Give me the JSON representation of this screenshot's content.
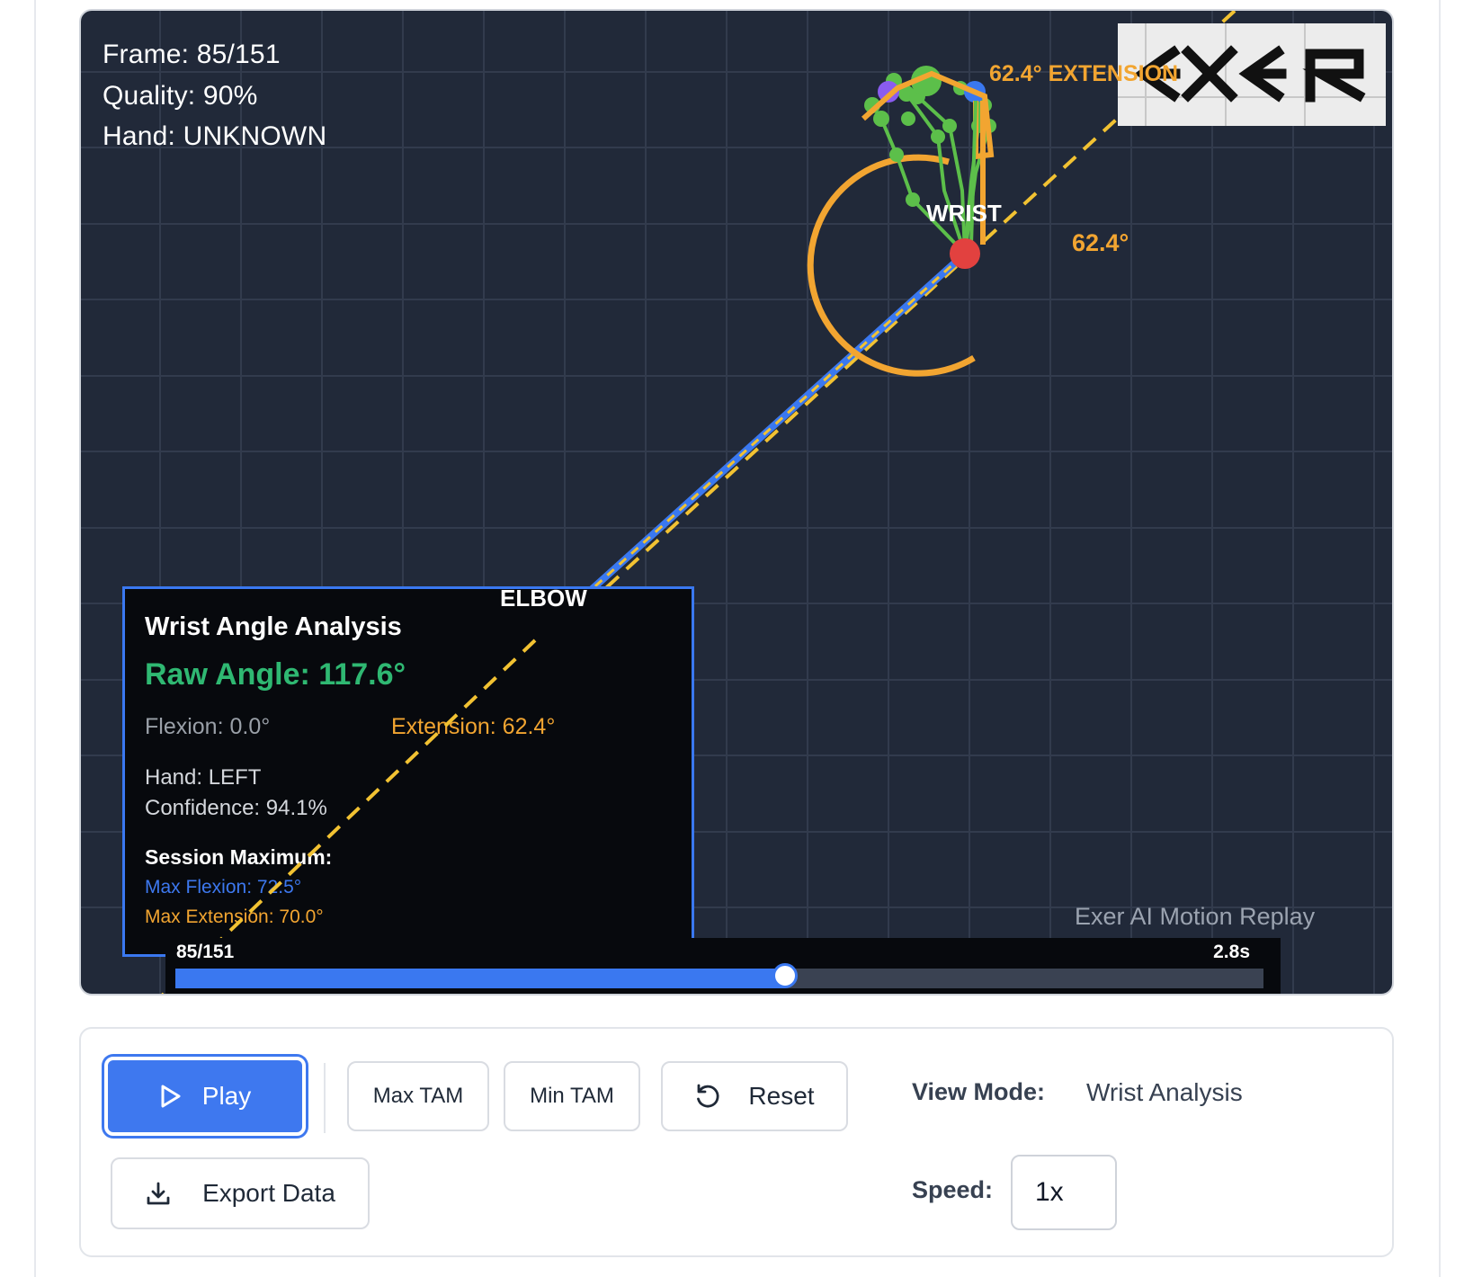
{
  "viewer": {
    "frame_text": "Frame: 85/151",
    "quality_text": "Quality: 90%",
    "hand_text": "Hand: UNKNOWN",
    "logo_text": "EXER",
    "wrist_label": "WRIST",
    "elbow_label": "ELBOW",
    "angle_near_wrist": "62.4°",
    "angle_top": "62.4° EXTENSION",
    "watermark": "Exer AI Motion Replay"
  },
  "analysis": {
    "title": "Wrist Angle Analysis",
    "raw_angle": "Raw Angle: 117.6°",
    "flexion": "Flexion: 0.0°",
    "extension": "Extension: 62.4°",
    "hand": "Hand: LEFT",
    "confidence": "Confidence: 94.1%",
    "session_title": "Session Maximum:",
    "max_flexion": "Max Flexion: 72.5°",
    "max_extension": "Max Extension: 70.0°"
  },
  "timeline": {
    "frame_label": "85/151",
    "time_label": "2.8s",
    "progress": 0.56
  },
  "controls": {
    "play_label": "Play",
    "max_tam_label": "Max TAM",
    "min_tam_label": "Min TAM",
    "reset_label": "Reset",
    "export_label": "Export Data",
    "view_mode_label": "View Mode:",
    "view_mode_value": "Wrist Analysis",
    "speed_label": "Speed:",
    "speed_value": "1x"
  },
  "colors": {
    "canvas_bg": "#212939",
    "accent_blue": "#3a78f0",
    "extension_orange": "#f2a531",
    "raw_angle_green": "#2fb872",
    "wrist_red": "#e2413f",
    "hand_green": "#5cbf4a"
  },
  "icons": [
    "play-icon",
    "reset-icon",
    "download-icon"
  ]
}
